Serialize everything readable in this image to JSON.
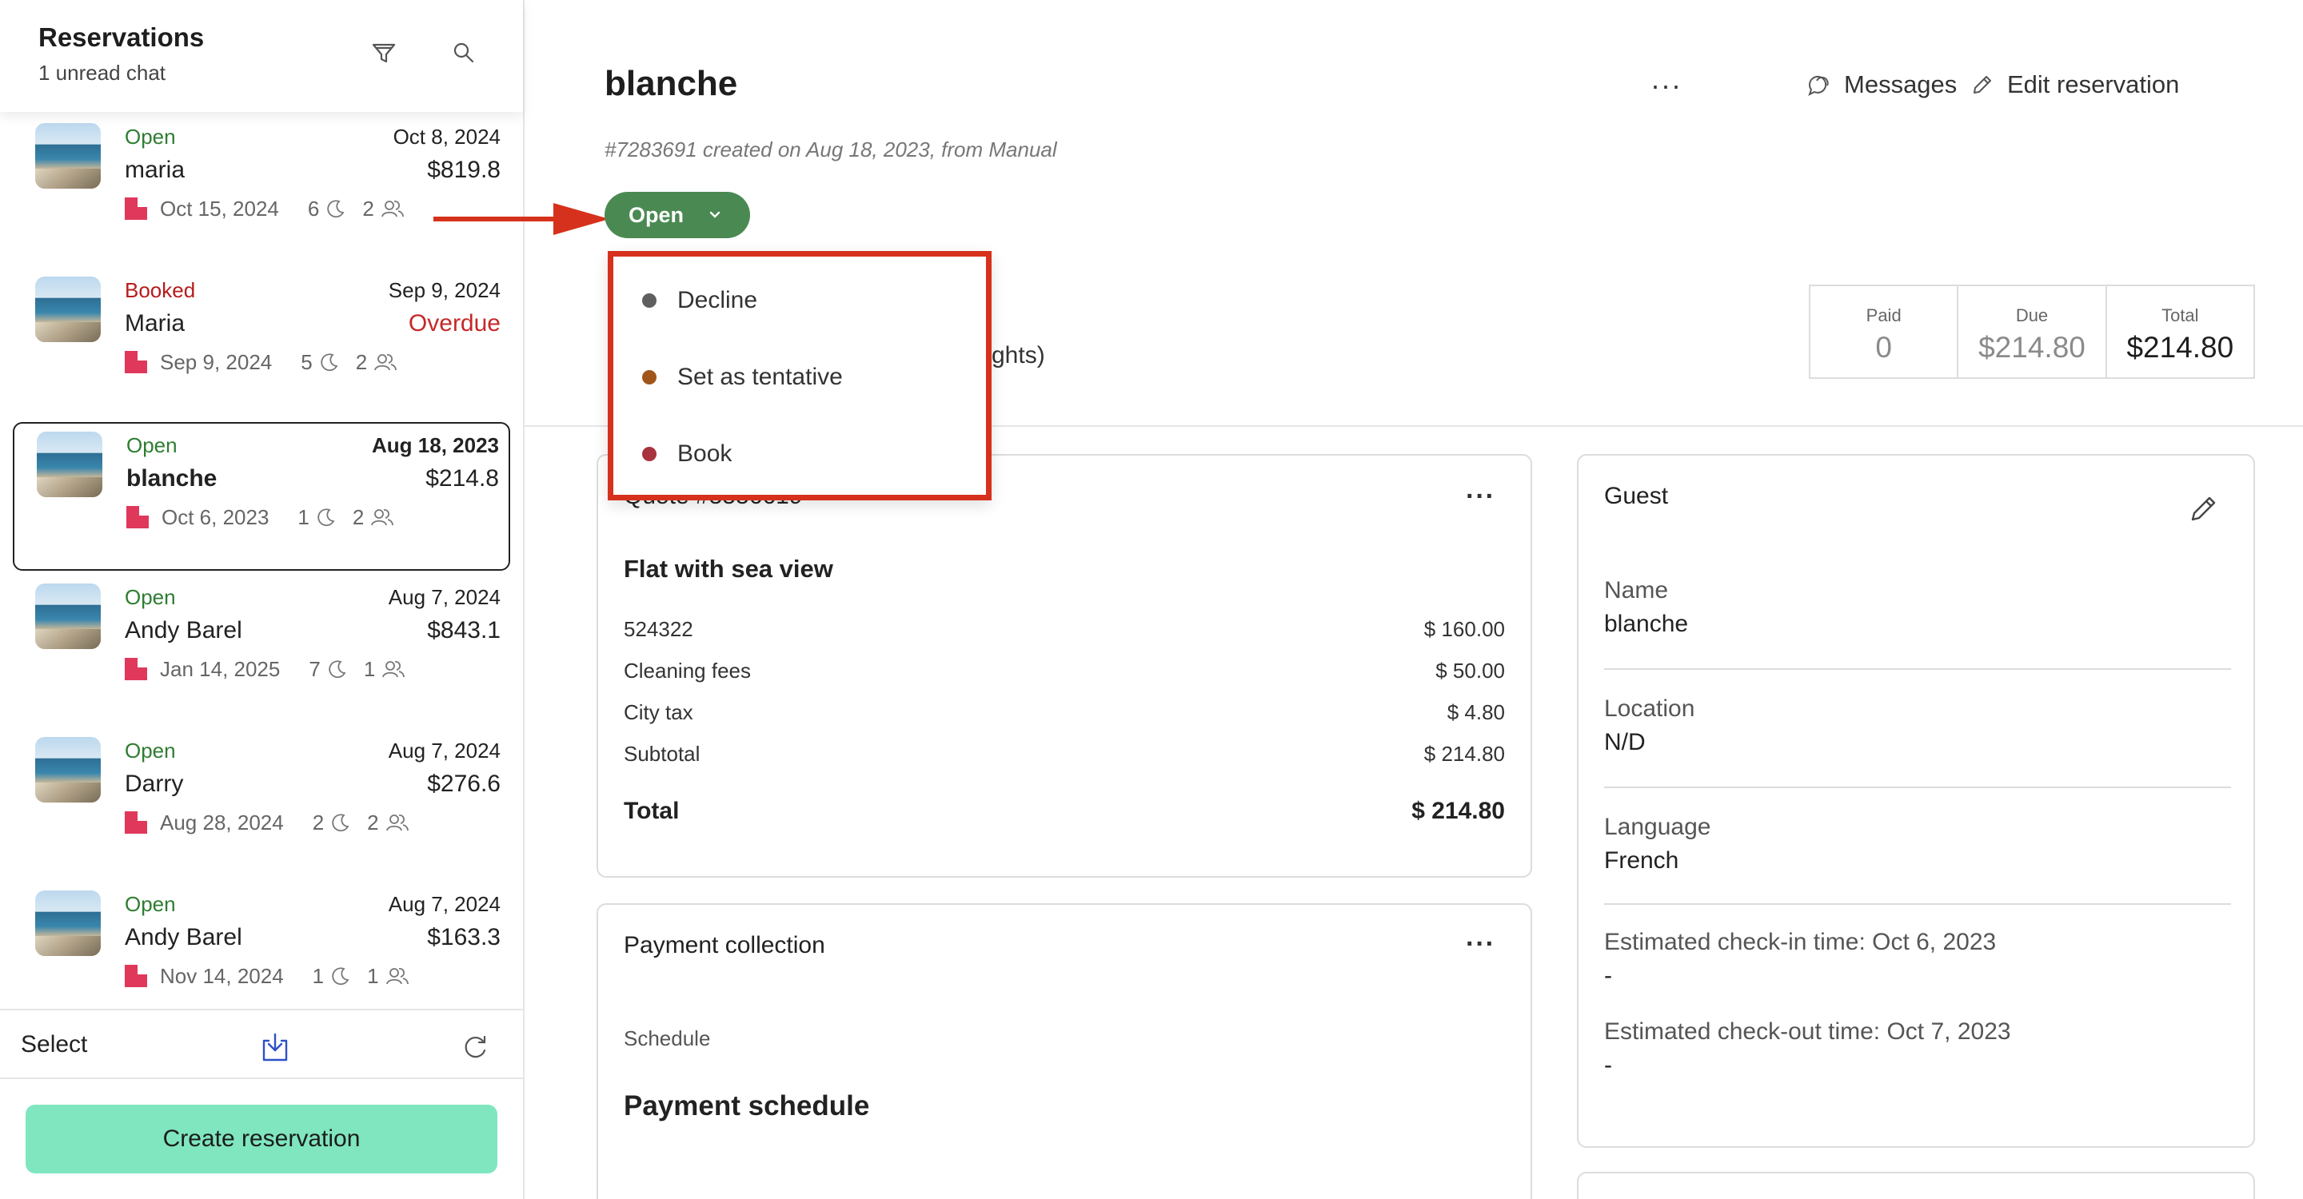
{
  "sidebar": {
    "title": "Reservations",
    "subtitle": "1 unread chat",
    "filter_icon": "filter-icon",
    "search_icon": "search-icon",
    "items": [
      {
        "status": "Open",
        "status_color": "#2e7d32",
        "date": "Oct 8, 2024",
        "name": "maria",
        "amount": "$819.8",
        "checkin": "Oct 15, 2024",
        "nights": "6",
        "guests": "2",
        "active": false
      },
      {
        "status": "Booked",
        "status_color": "#b71c1c",
        "date": "Sep 9, 2024",
        "name": "Maria",
        "amount": "Overdue",
        "checkin": "Sep 9, 2024",
        "nights": "5",
        "guests": "2",
        "active": false
      },
      {
        "status": "Open",
        "status_color": "#2e7d32",
        "date": "Aug 18, 2023",
        "name": "blanche",
        "amount": "$214.8",
        "checkin": "Oct 6, 2023",
        "nights": "1",
        "guests": "2",
        "active": true
      },
      {
        "status": "Open",
        "status_color": "#2e7d32",
        "date": "Aug 7, 2024",
        "name": "Andy Barel",
        "amount": "$843.1",
        "checkin": "Jan 14, 2025",
        "nights": "7",
        "guests": "1",
        "active": false
      },
      {
        "status": "Open",
        "status_color": "#2e7d32",
        "date": "Aug 7, 2024",
        "name": "Darry",
        "amount": "$276.6",
        "checkin": "Aug 28, 2024",
        "nights": "2",
        "guests": "2",
        "active": false
      },
      {
        "status": "Open",
        "status_color": "#2e7d32",
        "date": "Aug 7, 2024",
        "name": "Andy Barel",
        "amount": "$163.3",
        "checkin": "Nov 14, 2024",
        "nights": "1",
        "guests": "1",
        "active": false
      }
    ],
    "footer": {
      "select_label": "Select"
    },
    "create_label": "Create reservation",
    "create_color": "#7fe6c0"
  },
  "main": {
    "title": "blanche",
    "created": "#7283691 created on Aug 18, 2023, from Manual",
    "messages_label": "Messages",
    "edit_label": "Edit reservation",
    "more_label": "···",
    "status_button": {
      "label": "Open",
      "color": "#4a8a52"
    },
    "dropdown": {
      "highlight_color": "#d6311c",
      "items": [
        {
          "label": "Decline",
          "dot_color": "#5f5f5f"
        },
        {
          "label": "Set as tentative",
          "dot_color": "#a0561b"
        },
        {
          "label": "Book",
          "dot_color": "#a8323d"
        }
      ]
    },
    "nights_peek": "ghts)",
    "summary": {
      "paid_label": "Paid",
      "paid_value": "0",
      "due_label": "Due",
      "due_value": "$214.80",
      "total_label": "Total",
      "total_value": "$214.80"
    },
    "quote": {
      "title": "Quote #5556619",
      "listing": "Flat with sea view",
      "lines": [
        {
          "label": "524322",
          "value": "$ 160.00"
        },
        {
          "label": "Cleaning fees",
          "value": "$ 50.00"
        },
        {
          "label": "City tax",
          "value": "$ 4.80"
        },
        {
          "label": "Subtotal",
          "value": "$ 214.80"
        }
      ],
      "total_label": "Total",
      "total_value": "$ 214.80"
    },
    "payment": {
      "title": "Payment collection",
      "schedule_label": "Schedule",
      "schedule_title": "Payment schedule"
    },
    "guest": {
      "title": "Guest",
      "name_label": "Name",
      "name_value": "blanche",
      "location_label": "Location",
      "location_value": "N/D",
      "language_label": "Language",
      "language_value": "French",
      "checkin_label": "Estimated check-in time: Oct 6, 2023",
      "checkin_value": "-",
      "checkout_label": "Estimated check-out time: Oct 7, 2023",
      "checkout_value": "-"
    }
  }
}
